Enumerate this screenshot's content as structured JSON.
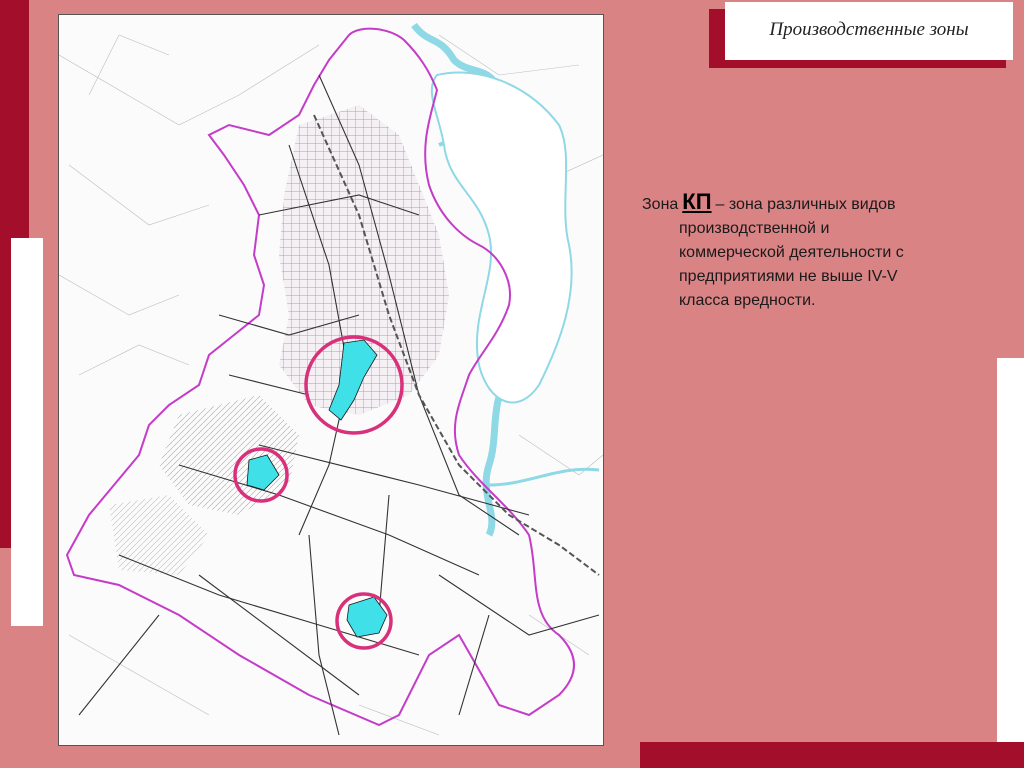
{
  "slide": {
    "title": "Производственные зоны",
    "description": {
      "prefix": "Зона",
      "zone_code": "КП",
      "line1_rest": "– зона различных видов",
      "line2": "производственной и",
      "line3": "коммерческой деятельности с",
      "line4": "предприятиями не выше IV-V",
      "line5": "класса вредности."
    }
  },
  "map": {
    "highlighted_zones": [
      {
        "name": "zone-kp-north"
      },
      {
        "name": "zone-kp-middle"
      },
      {
        "name": "zone-kp-south"
      }
    ],
    "colors": {
      "boundary": "#C43CC8",
      "circle": "#D8307A",
      "zone_fill": "#3FE0E8",
      "water": "#8FD8E6",
      "roads": "#333333",
      "railway": "#555555"
    }
  }
}
